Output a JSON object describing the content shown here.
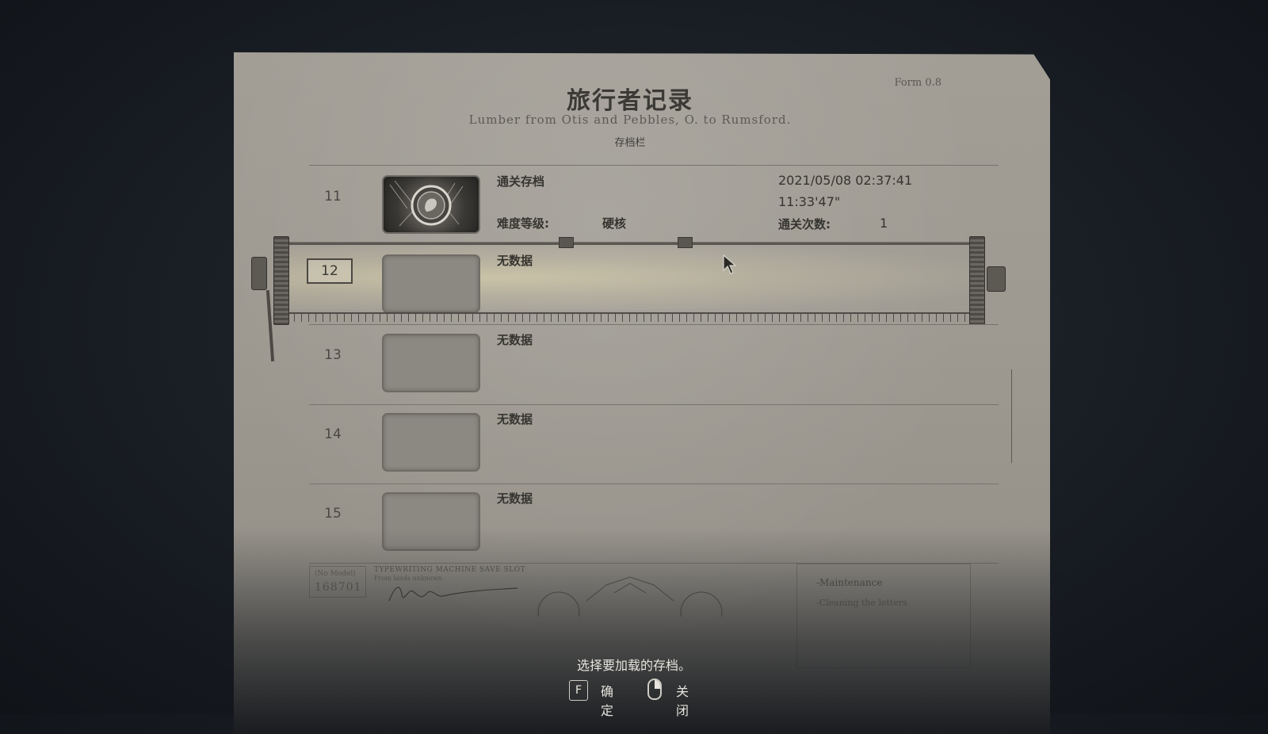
{
  "header": {
    "title": "旅行者记录",
    "subtitle": "Lumber from Otis and Pebbles, O. to Rumsford.",
    "section": "存档栏",
    "form_no": "Form 0.8"
  },
  "slots": [
    {
      "number": "11",
      "title": "通关存档",
      "datetime": "2021/05/08 02:37:41",
      "playtime": "11:33'47\"",
      "difficulty_label": "难度等级:",
      "difficulty_value": "硬核",
      "clears_label": "通关次数:",
      "clears_value": "1",
      "has_thumbnail": true
    },
    {
      "number": "12",
      "title": "无数据",
      "selected": true
    },
    {
      "number": "13",
      "title": "无数据"
    },
    {
      "number": "14",
      "title": "无数据"
    },
    {
      "number": "15",
      "title": "无数据"
    }
  ],
  "form_footer": {
    "serial_label": "(No Model)",
    "serial_value": "168701",
    "machine_label": "TYPEWRITING MACHINE SAVE SLOT",
    "machine_sub": "From lands unknown.",
    "maintenance_title": "-Maintenance",
    "maintenance_item": "-Cleaning the letters"
  },
  "footer": {
    "prompt": "选择要加载的存档。",
    "confirm_key": "F",
    "confirm_label": "确定",
    "close_label": "关闭"
  },
  "colors": {
    "paper": "#9e9a92",
    "background": "#1b2027",
    "ink": "#36342f",
    "highlight": "#e8deb2"
  },
  "icons": [
    "mouse-icon",
    "cursor-icon",
    "save-thumbnail-emblem-icon"
  ]
}
